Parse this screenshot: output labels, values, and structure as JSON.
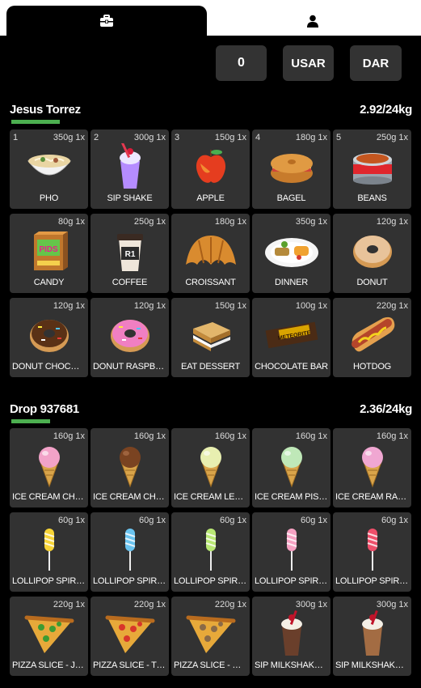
{
  "tabs": [
    {
      "label": "",
      "icon": "briefcase-icon"
    },
    {
      "label": "",
      "icon": "user-icon"
    }
  ],
  "controls": {
    "quantity": "0",
    "use_label": "USAR",
    "give_label": "DAR"
  },
  "player_inventory": {
    "title": "Jesus Torrez",
    "weight": "2.92/24kg",
    "weight_fill": 0.12,
    "accent": "#4caf50",
    "items": [
      {
        "slot": "1",
        "meta": "350g 1x",
        "label": "PHO",
        "icon": "pho-bowl-icon"
      },
      {
        "slot": "2",
        "meta": "300g 1x",
        "label": "SIP SHAKE",
        "icon": "shake-cup-icon"
      },
      {
        "slot": "3",
        "meta": "150g 1x",
        "label": "APPLE",
        "icon": "apple-icon"
      },
      {
        "slot": "4",
        "meta": "180g 1x",
        "label": "BAGEL",
        "icon": "bagel-icon"
      },
      {
        "slot": "5",
        "meta": "250g 1x",
        "label": "BEANS",
        "icon": "beans-can-icon"
      },
      {
        "slot": "",
        "meta": "80g 1x",
        "label": "CANDY",
        "icon": "candy-box-icon"
      },
      {
        "slot": "",
        "meta": "250g 1x",
        "label": "COFFEE",
        "icon": "coffee-cup-icon"
      },
      {
        "slot": "",
        "meta": "180g 1x",
        "label": "CROISSANT",
        "icon": "croissant-icon"
      },
      {
        "slot": "",
        "meta": "350g 1x",
        "label": "DINNER",
        "icon": "dinner-plate-icon"
      },
      {
        "slot": "",
        "meta": "120g 1x",
        "label": "DONUT",
        "icon": "donut-icon"
      },
      {
        "slot": "",
        "meta": "120g 1x",
        "label": "DONUT CHOCOLATE",
        "icon": "donut-chocolate-icon"
      },
      {
        "slot": "",
        "meta": "120g 1x",
        "label": "DONUT RASPBERRY",
        "icon": "donut-raspberry-icon"
      },
      {
        "slot": "",
        "meta": "150g 1x",
        "label": "EAT DESSERT",
        "icon": "dessert-sandwich-icon"
      },
      {
        "slot": "",
        "meta": "100g 1x",
        "label": "CHOCOLATE BAR",
        "icon": "chocolate-bar-icon"
      },
      {
        "slot": "",
        "meta": "220g 1x",
        "label": "HOTDOG",
        "icon": "hotdog-icon"
      }
    ]
  },
  "drop_inventory": {
    "title": "Drop 937681",
    "weight": "2.36/24kg",
    "weight_fill": 0.098,
    "accent": "#4caf50",
    "items": [
      {
        "slot": "",
        "meta": "160g 1x",
        "label": "ICE CREAM CHERRY",
        "icon": "ice-cream-cherry-icon"
      },
      {
        "slot": "",
        "meta": "160g 1x",
        "label": "ICE CREAM CHOCO...",
        "icon": "ice-cream-chocolate-icon"
      },
      {
        "slot": "",
        "meta": "160g 1x",
        "label": "ICE CREAM LEMON",
        "icon": "ice-cream-lemon-icon"
      },
      {
        "slot": "",
        "meta": "160g 1x",
        "label": "ICE CREAM PISTAC...",
        "icon": "ice-cream-pistachio-icon"
      },
      {
        "slot": "",
        "meta": "160g 1x",
        "label": "ICE CREAM RASPB...",
        "icon": "ice-cream-raspberry-icon"
      },
      {
        "slot": "",
        "meta": "60g 1x",
        "label": "LOLLIPOP SPIRAL Y...",
        "icon": "lollipop-yellow-icon"
      },
      {
        "slot": "",
        "meta": "60g 1x",
        "label": "LOLLIPOP SPIRAL ...",
        "icon": "lollipop-blue-icon"
      },
      {
        "slot": "",
        "meta": "60g 1x",
        "label": "LOLLIPOP SPIRAL ...",
        "icon": "lollipop-green-icon"
      },
      {
        "slot": "",
        "meta": "60g 1x",
        "label": "LOLLIPOP SPIRAL P...",
        "icon": "lollipop-pink-icon"
      },
      {
        "slot": "",
        "meta": "60g 1x",
        "label": "LOLLIPOP SPIRAL R...",
        "icon": "lollipop-red-icon"
      },
      {
        "slot": "",
        "meta": "220g 1x",
        "label": "PIZZA SLICE - JALA...",
        "icon": "pizza-jalapeno-icon"
      },
      {
        "slot": "",
        "meta": "220g 1x",
        "label": "PIZZA SLICE - TOM...",
        "icon": "pizza-tomato-icon"
      },
      {
        "slot": "",
        "meta": "220g 1x",
        "label": "PIZZA SLICE - MUS...",
        "icon": "pizza-mushroom-icon"
      },
      {
        "slot": "",
        "meta": "300g 1x",
        "label": "SIP MILKSHAKE - C...",
        "icon": "milkshake-cherry-icon"
      },
      {
        "slot": "",
        "meta": "300g 1x",
        "label": "SIP MILKSHAKE - C...",
        "icon": "milkshake-coffee-icon"
      }
    ]
  }
}
